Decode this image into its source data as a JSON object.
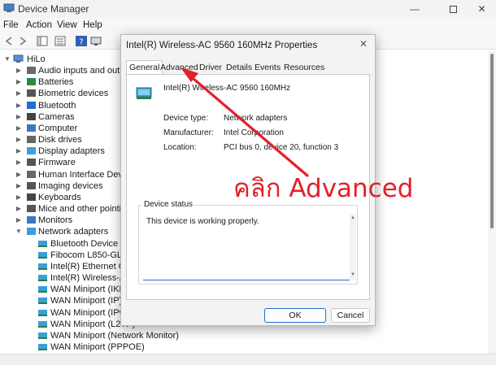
{
  "window": {
    "title": "Device Manager"
  },
  "menubar": {
    "items": [
      "File",
      "Action",
      "View",
      "Help"
    ]
  },
  "tree": {
    "root": "HiLo",
    "categories": [
      "Audio inputs and outpu",
      "Batteries",
      "Biometric devices",
      "Bluetooth",
      "Cameras",
      "Computer",
      "Disk drives",
      "Display adapters",
      "Firmware",
      "Human Interface Devices",
      "Imaging devices",
      "Keyboards",
      "Mice and other pointing",
      "Monitors",
      "Network adapters"
    ],
    "network_children": [
      "Bluetooth Device (Pe",
      "Fibocom L850-GL",
      "Intel(R) Ethernet Con",
      "Intel(R) Wireless-AC 9",
      "WAN Miniport (IKEv2",
      "WAN Miniport (IP)",
      "WAN Miniport (IPv6)",
      "WAN Miniport (L2TP)",
      "WAN Miniport (Network Monitor)",
      "WAN Miniport (PPPOE)"
    ]
  },
  "dialog": {
    "title": "Intel(R) Wireless-AC 9560 160MHz Properties",
    "tabs": [
      "General",
      "Advanced",
      "Driver",
      "Details",
      "Events",
      "Resources"
    ],
    "active_tab": "General",
    "device_name": "Intel(R) Wireless-AC 9560 160MHz",
    "properties": [
      {
        "label": "Device type:",
        "value": "Network adapters"
      },
      {
        "label": "Manufacturer:",
        "value": "Intel Corporation"
      },
      {
        "label": "Location:",
        "value": "PCI bus 0, device 20, function 3"
      }
    ],
    "status_group_label": "Device status",
    "status_text": "This device is working properly.",
    "ok_label": "OK",
    "cancel_label": "Cancel"
  },
  "annotation": {
    "text": "คลิก Advanced",
    "color": "#e3202a"
  },
  "colors": {
    "accent": "#1f6fd0",
    "annotation": "#e3202a"
  }
}
